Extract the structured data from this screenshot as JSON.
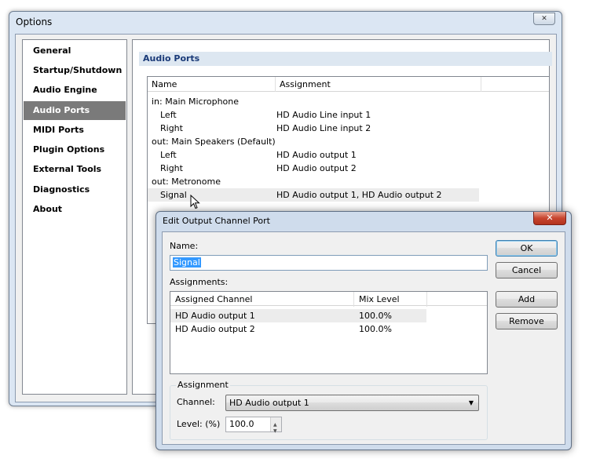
{
  "options_window": {
    "title": "Options",
    "nav": [
      {
        "label": "General"
      },
      {
        "label": "Startup/Shutdown"
      },
      {
        "label": "Audio Engine"
      },
      {
        "label": "Audio Ports",
        "selected": true
      },
      {
        "label": "MIDI Ports"
      },
      {
        "label": "Plugin Options"
      },
      {
        "label": "External Tools"
      },
      {
        "label": "Diagnostics"
      },
      {
        "label": "About"
      }
    ],
    "section_title": "Audio Ports",
    "columns": {
      "name": "Name",
      "assignment": "Assignment"
    },
    "rows": [
      {
        "name": "in: Main Microphone",
        "assignment": ""
      },
      {
        "name": "Left",
        "assignment": "HD Audio Line input 1"
      },
      {
        "name": "Right",
        "assignment": "HD Audio Line input 2"
      },
      {
        "name": "out: Main Speakers (Default)",
        "assignment": ""
      },
      {
        "name": "Left",
        "assignment": "HD Audio output 1"
      },
      {
        "name": "Right",
        "assignment": "HD Audio output 2"
      },
      {
        "name": "out: Metronome",
        "assignment": ""
      },
      {
        "name": "Signal",
        "assignment": "HD Audio output 1, HD Audio output 2"
      }
    ]
  },
  "edit_dialog": {
    "title": "Edit Output Channel Port",
    "close_glyph": "✕",
    "name_label": "Name:",
    "name_value": "Signal",
    "assignments_label": "Assignments:",
    "columns": {
      "channel": "Assigned Channel",
      "mix": "Mix Level"
    },
    "assignments": [
      {
        "channel": "HD Audio output 1",
        "mix": "100.0%"
      },
      {
        "channel": "HD Audio output 2",
        "mix": "100.0%"
      }
    ],
    "buttons": {
      "ok": "OK",
      "cancel": "Cancel",
      "add": "Add",
      "remove": "Remove"
    },
    "assignment_group": {
      "title": "Assignment",
      "channel_label": "Channel:",
      "channel_value": "HD Audio output 1",
      "level_label": "Level: (%)",
      "level_value": "100.0"
    }
  },
  "colors": {
    "selection": "#3399ff",
    "nav_selected": "#7a7a7a",
    "section_header_text": "#1a3a78"
  }
}
